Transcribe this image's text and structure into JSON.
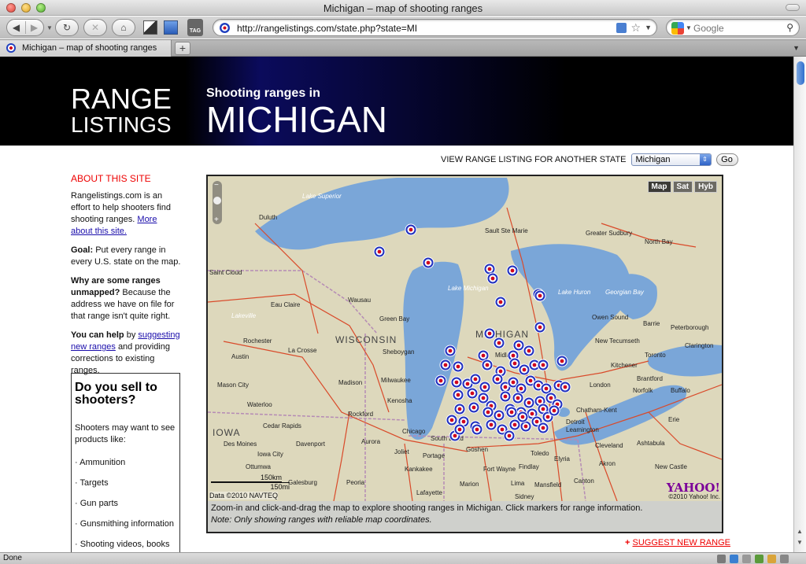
{
  "window": {
    "title": "Michigan – map of shooting ranges"
  },
  "toolbar": {
    "url": "http://rangelistings.com/state.php?state=MI",
    "search_placeholder": "Google",
    "tag_label": "TAG"
  },
  "tabs": [
    {
      "label": "Michigan – map of shooting ranges"
    }
  ],
  "banner": {
    "logo_line1": "RANGE",
    "logo_line2": "LISTINGS",
    "subtitle": "Shooting ranges in",
    "state": "MICHIGAN"
  },
  "state_picker": {
    "label": "VIEW RANGE LISTING FOR ANOTHER STATE",
    "selected": "Michigan",
    "go_label": "Go"
  },
  "sidebar": {
    "about_heading": "ABOUT THIS SITE",
    "intro": "Rangelistings.com is an effort to help shooters find shooting ranges.",
    "more_link": "More about this site.",
    "goal_label": "Goal:",
    "goal_text": "Put every range in every U.S. state on the map.",
    "unmapped_label": "Why are some ranges unmapped?",
    "unmapped_text": "Because the address we have on file for that range isn't quite right.",
    "help_label": "You can help",
    "help_by": "by",
    "help_link": "suggesting new ranges",
    "help_text": "and providing corrections to existing ranges."
  },
  "sell_box": {
    "title": "Do you sell to shooters?",
    "intro": "Shooters may want to see products like:",
    "items": [
      "· Ammunition",
      "· Targets",
      "· Gun parts",
      "· Gunsmithing information",
      "· Shooting videos, books"
    ]
  },
  "map": {
    "buttons": [
      "Map",
      "Sat",
      "Hyb"
    ],
    "active_button": "Map",
    "scale_km": "150km",
    "scale_mi": "150mi",
    "credit": "Data ©2010 NAVTEQ",
    "provider": "YAHOO!",
    "provider_copy": "©2010 Yahoo! Inc.",
    "labels": [
      "Lake Superior",
      "Lake Michigan",
      "Lake Huron",
      "Georgian Bay",
      "MICHIGAN",
      "WISCONSIN",
      "IOWA",
      "Duluth",
      "Sault Ste Marie",
      "Greater Sudbury",
      "North Bay",
      "Eau Claire",
      "Wausau",
      "Green Bay",
      "Rochester",
      "La Crosse",
      "Austin",
      "Mason City",
      "Madison",
      "Milwaukee",
      "Kenosha",
      "Rockford",
      "Chicago",
      "Des Moines",
      "Iowa City",
      "Davenport",
      "Cedar Rapids",
      "Waterloo",
      "Aurora",
      "South Bend",
      "Fort Wayne",
      "Toledo",
      "Detroit",
      "London",
      "Kitchener",
      "Toronto",
      "Barrie",
      "Owen Sound",
      "New Tecumseth",
      "Peterborough",
      "Clarington",
      "Buffalo",
      "Erie",
      "Cleveland",
      "Akron",
      "Canton",
      "Findlay",
      "Lima",
      "Mansfield",
      "Sidney",
      "Marion",
      "Peoria",
      "Galesburg",
      "Ottumwa",
      "Kankakee",
      "Joliet",
      "Portage",
      "Goshen",
      "Sheboygan",
      "Chatham-Kent",
      "Leamington",
      "Norfolk",
      "Brantford",
      "Ashtabula",
      "Elyria",
      "New Castle",
      "Lafayette",
      "Lakeville",
      "Saint Cloud",
      "Midland"
    ],
    "marker_count_description": ""
  },
  "map_caption": {
    "line1": "Zoom-in and click-and-drag the map to explore shooting ranges in Michigan. Click markers for range information.",
    "line2": "Note: Only showing ranges with reliable map coordinates."
  },
  "suggest": {
    "prefix": "+",
    "label": "SUGGEST NEW RANGE"
  },
  "status": {
    "text": "Done"
  },
  "colors": {
    "lake": "#7aa6d8",
    "land": "#e0dcc0",
    "marker_ring": "#1f2fbf",
    "marker_center": "#d0021b",
    "banner_accent": "#0b0b5c",
    "alert_red": "#e00000"
  }
}
